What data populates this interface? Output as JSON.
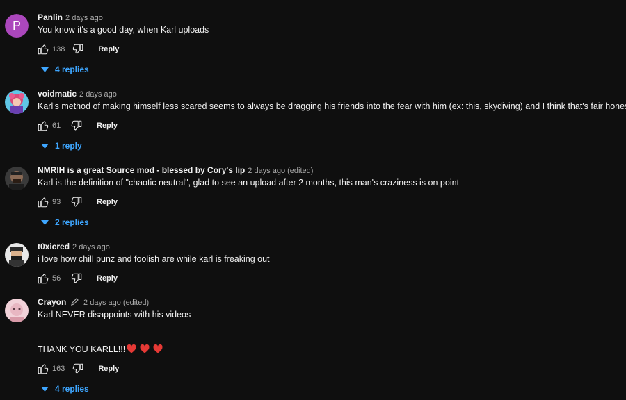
{
  "comments": [
    {
      "author": "Panlin",
      "avatar_letter": "P",
      "avatar_color": "#ab47bc",
      "meta": "2 days ago",
      "text": "You know it's a good day, when Karl uploads",
      "likes": "138",
      "reply_label": "Reply",
      "replies_label": "4 replies"
    },
    {
      "author": "voidmatic",
      "meta": "2 days ago",
      "text": "Karl's method of making himself less scared seems to always be dragging his friends into the fear with him (ex: this, skydiving) and I think that's fair honestly lol",
      "likes": "61",
      "reply_label": "Reply",
      "replies_label": "1 reply"
    },
    {
      "author": "NMRIH is a great Source mod - blessed by Cory's lip",
      "meta": "2 days ago (edited)",
      "text": "Karl is the definition of \"chaotic neutral\", glad to see an upload after 2 months, this man's craziness is on point",
      "likes": "93",
      "reply_label": "Reply",
      "replies_label": "2 replies"
    },
    {
      "author": "t0xicred",
      "meta": "2 days ago",
      "text": "i love how chill punz and foolish are while karl is freaking out",
      "likes": "56",
      "reply_label": "Reply"
    },
    {
      "author": "Crayon",
      "meta": "2 days ago (edited)",
      "text": "Karl NEVER disappoints with his videos",
      "text2": "THANK YOU KARLL!!!",
      "likes": "163",
      "reply_label": "Reply",
      "replies_label": "4 replies"
    }
  ],
  "colors": {
    "background": "#0f0f0f",
    "text": "#f1f1f1",
    "secondary": "#aaaaaa",
    "link_blue": "#3ea6ff",
    "heart": "#e53935"
  },
  "icons": {
    "like": "thumbs-up-icon",
    "dislike": "thumbs-down-icon",
    "expand": "caret-down-icon",
    "edit": "pencil-icon",
    "emoji": "red-heart-icon"
  }
}
